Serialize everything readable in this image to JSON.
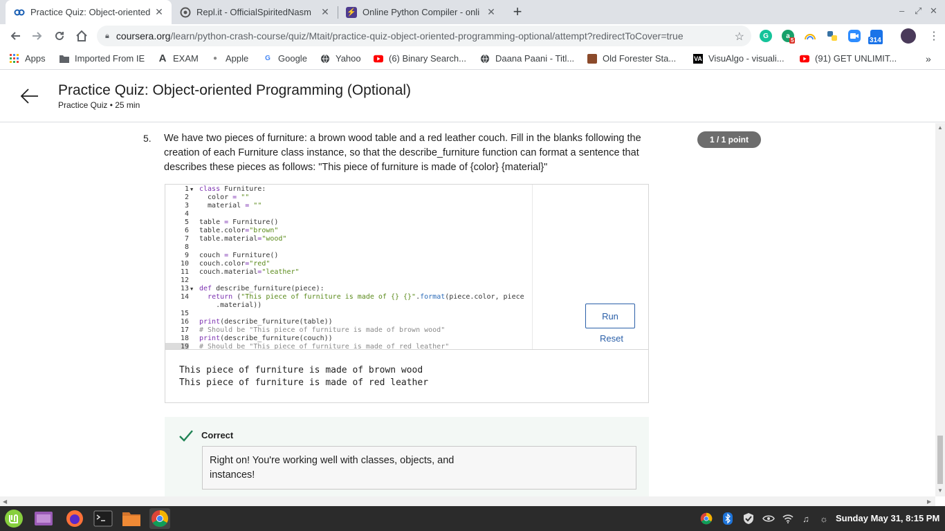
{
  "browser": {
    "tabs": [
      {
        "title": "Practice Quiz: Object-oriented",
        "favicon": "coursera-icon",
        "active": true
      },
      {
        "title": "Repl.it - OfficialSpiritedNasm",
        "favicon": "replit-icon",
        "active": false
      },
      {
        "title": "Online Python Compiler - onli",
        "favicon": "lightning-icon",
        "active": false
      }
    ],
    "url_host": "coursera.org",
    "url_path": "/learn/python-crash-course/quiz/Mtait/practice-quiz-object-oriented-programming-optional/attempt?redirectToCover=true",
    "extensions": [
      {
        "name": "grammarly-icon",
        "color": "#15c39a",
        "label": "G",
        "badge": ""
      },
      {
        "name": "extension-a-icon",
        "color": "#18a06a",
        "label": "a",
        "badge": "5"
      },
      {
        "name": "rainbow-icon",
        "color": "#e0e0e0",
        "label": "",
        "badge": ""
      },
      {
        "name": "python-icon",
        "color": "#3772a4",
        "label": "",
        "badge": ""
      },
      {
        "name": "zoom-icon",
        "color": "#2d8cff",
        "label": "",
        "badge": ""
      },
      {
        "name": "calendar-icon",
        "color": "#1a73e8",
        "label": "",
        "badge": "314"
      }
    ]
  },
  "bookmarks": [
    {
      "label": "Apps",
      "icon": "apps-grid-icon"
    },
    {
      "label": "Imported From IE",
      "icon": "folder-icon"
    },
    {
      "label": "EXAM",
      "icon": "a-logo-icon"
    },
    {
      "label": "Apple",
      "icon": "apple-icon"
    },
    {
      "label": "Google",
      "icon": "google-icon"
    },
    {
      "label": "Yahoo",
      "icon": "globe-icon"
    },
    {
      "label": "(6) Binary Search...",
      "icon": "youtube-icon"
    },
    {
      "label": "Daana Paani - Titl...",
      "icon": "globe-icon"
    },
    {
      "label": "Old Forester Sta...",
      "icon": "forester-icon"
    },
    {
      "label": "VisuAlgo - visuali...",
      "icon": "visualgo-icon"
    },
    {
      "label": "(91) GET UNLIMIT...",
      "icon": "youtube-icon"
    }
  ],
  "header": {
    "title": "Practice Quiz: Object-oriented Programming (Optional)",
    "subtitle": "Practice Quiz • 25 min"
  },
  "question": {
    "number": "5.",
    "text": "We have two pieces of furniture: a brown wood table and a red leather couch. Fill in the blanks following the creation of each Furniture class instance, so that the describe_furniture function can format a sentence that describes these pieces as follows: \"This piece of furniture is made of {color} {material}\"",
    "points": "1 / 1 point"
  },
  "editor": {
    "line_numbers": [
      "1",
      "2",
      "3",
      "4",
      "5",
      "6",
      "7",
      "8",
      "9",
      "10",
      "11",
      "12",
      "13",
      "14",
      "",
      "15",
      "16",
      "17",
      "18",
      "19"
    ],
    "run_label": "Run",
    "reset_label": "Reset",
    "output_lines": [
      "This piece of furniture is made of brown wood",
      "This piece of furniture is made of red leather"
    ]
  },
  "feedback": {
    "status": "Correct",
    "message_line1": "Right on! You're working well with classes, objects, and",
    "message_line2": "instances!"
  },
  "taskbar": {
    "clock": "Sunday May 31,  8:15 PM"
  }
}
